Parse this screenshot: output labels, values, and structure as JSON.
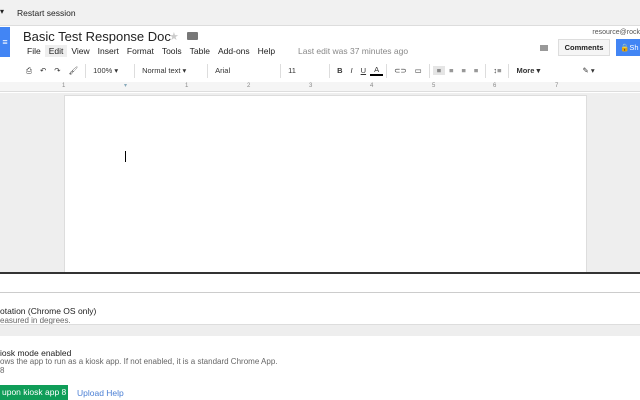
{
  "topbar": {
    "menu_arrow": "▾",
    "restart_label": "Restart session"
  },
  "docs": {
    "title": "Basic Test Response Doc",
    "account": "resource@rock",
    "comments_label": "Comments",
    "share_label": "Sh",
    "menu": [
      "File",
      "Edit",
      "View",
      "Insert",
      "Format",
      "Tools",
      "Table",
      "Add-ons",
      "Help"
    ],
    "last_edit": "Last edit was 37 minutes ago",
    "toolbar": {
      "zoom": "100%",
      "style": "Normal text",
      "font": "Arial",
      "size": "11",
      "bold": "B",
      "italic": "I",
      "underline": "U",
      "color": "A",
      "more": "More"
    },
    "ruler": [
      "1",
      "1",
      "2",
      "3",
      "4",
      "5",
      "6",
      "7"
    ]
  },
  "panel": {
    "rotation_title": "otation (Chrome OS only)",
    "rotation_desc": "easured in degrees.",
    "kiosk_title": "iosk mode enabled",
    "kiosk_desc": "ows the app to run as a kiosk app. If not enabled, it is a standard Chrome App.",
    "kiosk_extra": "8",
    "upload_button": "upon kiosk app 8",
    "upload_help": "Upload Help"
  },
  "colors": {
    "accent": "#4285f4",
    "green": "#0f9d58",
    "link": "#4a7fd4"
  }
}
